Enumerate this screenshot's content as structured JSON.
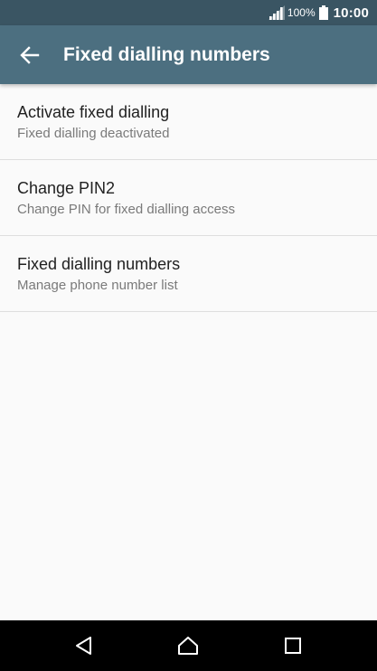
{
  "status_bar": {
    "battery_percent": "100%",
    "time": "10:00",
    "signal_icon": "signal-icon",
    "battery_icon": "battery-icon"
  },
  "app_bar": {
    "back_icon": "arrow-back-icon",
    "title": "Fixed dialling numbers",
    "background_color": "#4c6f80",
    "status_color": "#3a5563"
  },
  "settings": {
    "items": [
      {
        "title": "Activate fixed dialling",
        "subtitle": "Fixed dialling deactivated"
      },
      {
        "title": "Change PIN2",
        "subtitle": "Change PIN for fixed dialling access"
      },
      {
        "title": "Fixed dialling numbers",
        "subtitle": "Manage phone number list"
      }
    ]
  },
  "nav_bar": {
    "back_icon": "nav-back-icon",
    "home_icon": "nav-home-icon",
    "recents_icon": "nav-recents-icon"
  }
}
